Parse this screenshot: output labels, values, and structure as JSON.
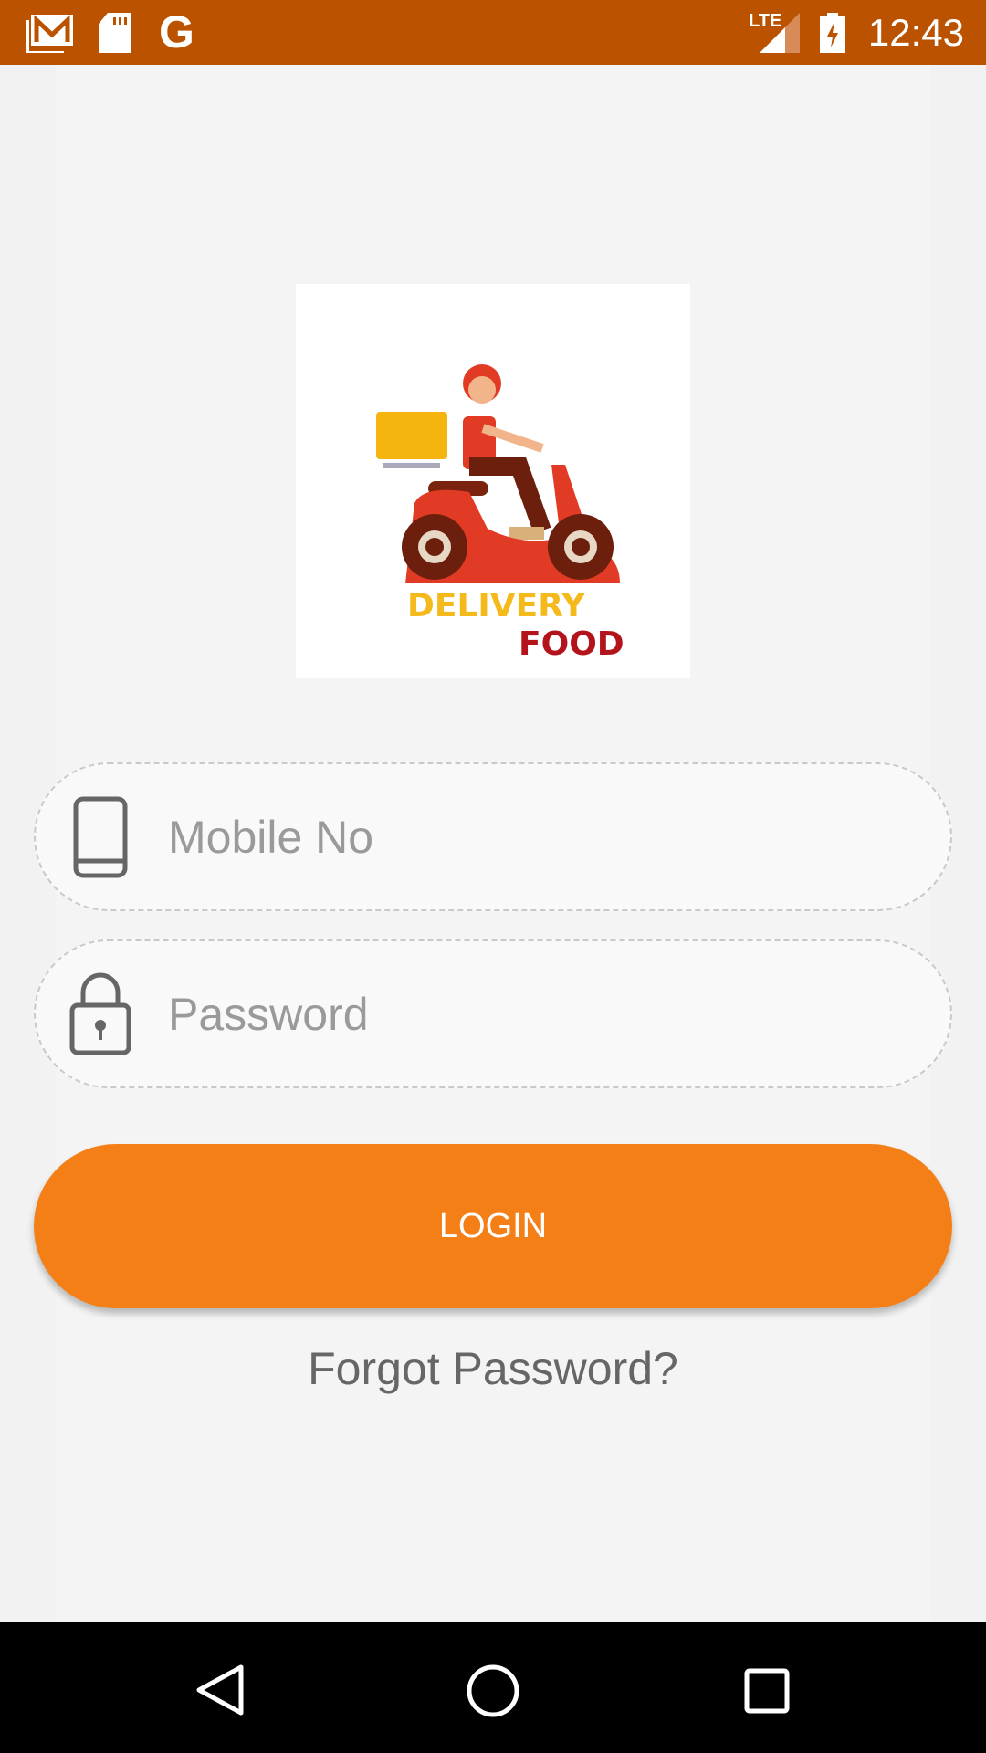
{
  "status_bar": {
    "time": "12:43",
    "network": "LTE",
    "icons": [
      "gmail-icon",
      "sd-card-icon",
      "google-icon",
      "signal-icon",
      "battery-charging-icon"
    ],
    "background": "#bb5200"
  },
  "logo": {
    "line1": "DELIVERY",
    "line2": "FOOD"
  },
  "form": {
    "mobile": {
      "placeholder": "Mobile No",
      "value": "",
      "icon": "phone-icon"
    },
    "password": {
      "placeholder": "Password",
      "value": "",
      "icon": "lock-icon"
    },
    "login_label": "LOGIN",
    "forgot_label": "Forgot Password?",
    "accent": "#f57f17"
  },
  "nav_bar": {
    "icons": [
      "back-icon",
      "home-icon",
      "recents-icon"
    ]
  }
}
